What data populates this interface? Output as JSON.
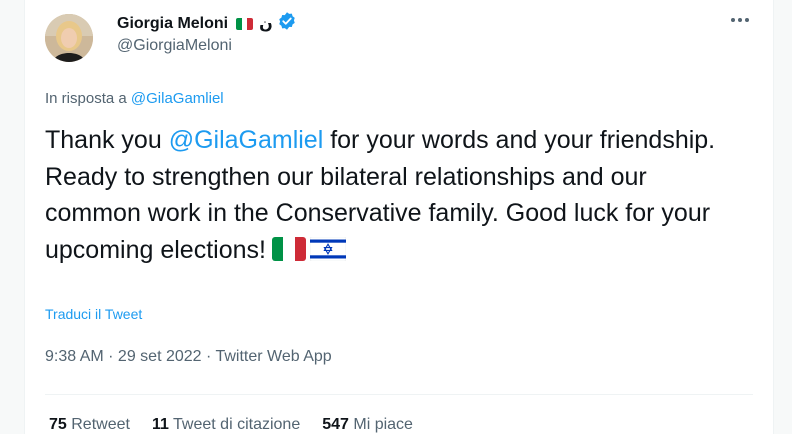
{
  "author": {
    "name": "Giorgia Meloni",
    "name_suffix": "ن",
    "handle": "@GiorgiaMeloni",
    "verified": true
  },
  "reply": {
    "prefix": "In risposta a",
    "handle": "@GilaGamliel"
  },
  "tweet": {
    "pre": "Thank you ",
    "mention": "@GilaGamliel",
    "post": " for your words and your friendship. Ready to strengthen our bilateral relationships and our common work in the Conservative family. Good luck for your upcoming elections!"
  },
  "translate_label": "Traduci il Tweet",
  "meta_line": "9:38 AM · 29 set 2022 · Twitter Web App",
  "stats": {
    "retweets_count": "75",
    "retweets_label": "Retweet",
    "quotes_count": "11",
    "quotes_label": "Tweet di citazione",
    "likes_count": "547",
    "likes_label": "Mi piace"
  },
  "colors": {
    "link": "#1d9bf0",
    "muted": "#536471",
    "text": "#0f1419",
    "italy_green": "#009246",
    "italy_red": "#ce2b37",
    "israel_blue": "#0038b8"
  },
  "icons": [
    "verified-badge-icon",
    "more-options-icon",
    "italy-flag-icon",
    "israel-flag-icon"
  ]
}
